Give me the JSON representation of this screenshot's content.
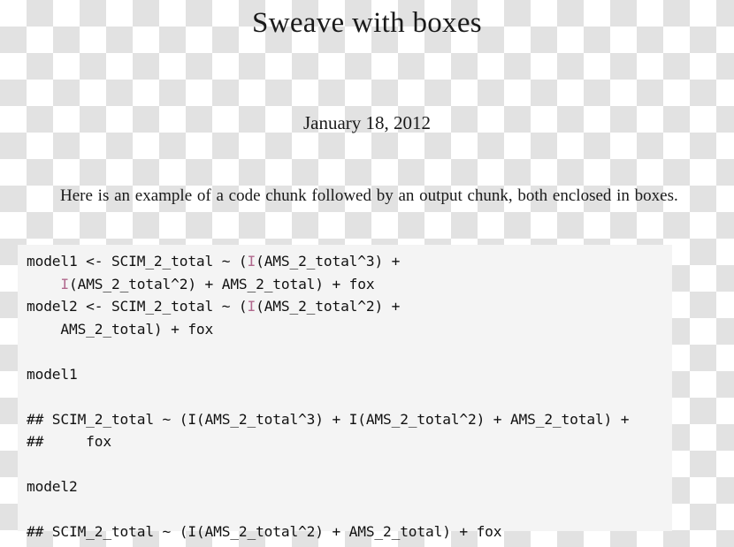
{
  "document": {
    "title": "Sweave with boxes",
    "date": "January 18, 2012",
    "paragraph": "Here is an example of a code chunk followed by an output chunk, both enclosed in boxes."
  },
  "code_block": {
    "background_color": "#f4f4f4",
    "highlight_color": "#b0688d",
    "text_color": "#111111",
    "lines": [
      {
        "id": "l1",
        "segments": [
          {
            "t": "model1 <- SCIM_2_total ~ ("
          },
          {
            "t": "I",
            "hl": true
          },
          {
            "t": "(AMS_2_total^3) +"
          }
        ]
      },
      {
        "id": "l2",
        "segments": [
          {
            "t": "    "
          },
          {
            "t": "I",
            "hl": true
          },
          {
            "t": "(AMS_2_total^2) + AMS_2_total) + fox"
          }
        ]
      },
      {
        "id": "l3",
        "segments": [
          {
            "t": "model2 <- SCIM_2_total ~ ("
          },
          {
            "t": "I",
            "hl": true
          },
          {
            "t": "(AMS_2_total^2) +"
          }
        ]
      },
      {
        "id": "l4",
        "segments": [
          {
            "t": "    AMS_2_total) + fox"
          }
        ]
      },
      {
        "id": "l5",
        "segments": [
          {
            "t": ""
          }
        ]
      },
      {
        "id": "l6",
        "segments": [
          {
            "t": "model1"
          }
        ]
      },
      {
        "id": "l7",
        "segments": [
          {
            "t": ""
          }
        ]
      },
      {
        "id": "l8",
        "segments": [
          {
            "t": "## SCIM_2_total ~ (I(AMS_2_total^3) + I(AMS_2_total^2) + AMS_2_total) +"
          }
        ]
      },
      {
        "id": "l9",
        "segments": [
          {
            "t": "##     fox"
          }
        ]
      },
      {
        "id": "l10",
        "segments": [
          {
            "t": ""
          }
        ]
      },
      {
        "id": "l11",
        "segments": [
          {
            "t": "model2"
          }
        ]
      },
      {
        "id": "l12",
        "segments": [
          {
            "t": ""
          }
        ]
      },
      {
        "id": "l13",
        "segments": [
          {
            "t": "## SCIM_2_total ~ (I(AMS_2_total^2) + AMS_2_total) + fox"
          }
        ]
      }
    ]
  }
}
